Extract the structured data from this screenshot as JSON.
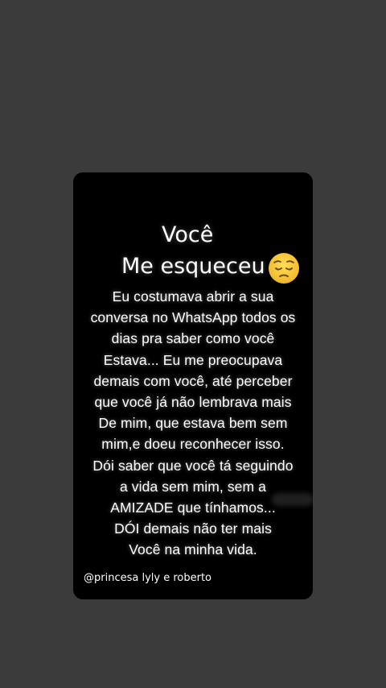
{
  "story": {
    "title_line1": "Você",
    "title_line2": "Me esqueceu",
    "emoji": "pensive-face-icon",
    "body_lines": [
      "Eu costumava abrir a sua",
      "conversa no WhatsApp todos os",
      "dias pra saber como você",
      "Estava... Eu me preocupava",
      "demais com você, até perceber",
      "que você já não lembrava mais",
      "De mim, que estava bem sem",
      "mim,e doeu reconhecer isso.",
      "Dói saber que você tá seguindo",
      "a vida sem mim, sem a",
      "AMIZADE que tínhamos...",
      "DÓI demais não ter mais",
      "Você na minha vida."
    ],
    "credit": "@princesa lyly e roberto"
  },
  "colors": {
    "page_background": "#3b3b3b",
    "card_background": "#000000",
    "text": "#ffffff",
    "emoji_fill": "#f6c23e"
  }
}
